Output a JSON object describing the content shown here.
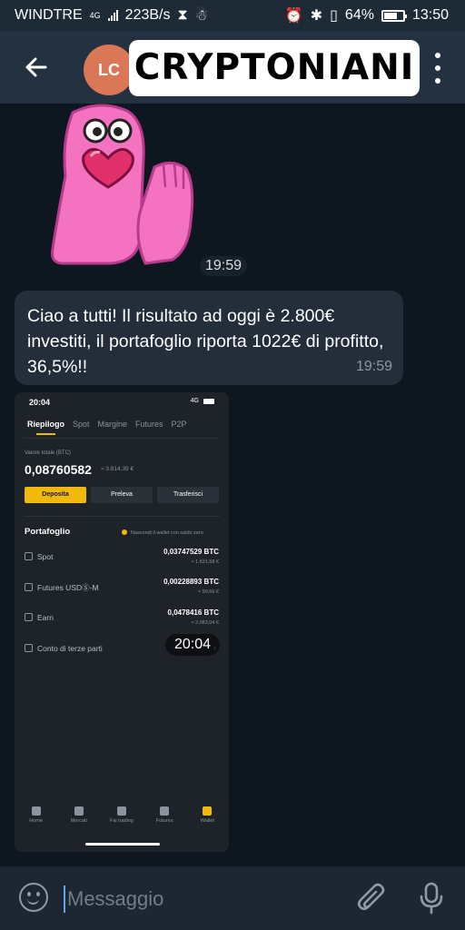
{
  "status_bar": {
    "carrier": "WINDTRE",
    "network": "4G",
    "speed": "223B/s",
    "battery": "64%",
    "time": "13:50"
  },
  "header": {
    "avatar_initials": "LC",
    "title": "CRYPTONIANI"
  },
  "messages": {
    "sticker_time": "19:59",
    "text": "Ciao a tutti! Il risultato ad oggi è 2.800€ investiti, il portafoglio riporta 1022€ di profitto, 36,5%!!",
    "text_time": "19:59",
    "image_time": "20:04"
  },
  "screenshot": {
    "status_time": "20:04",
    "status_network": "4G",
    "tabs": [
      "Riepilogo",
      "Spot",
      "Margine",
      "Futures",
      "P2P"
    ],
    "total_label": "Valore totale (BTC)",
    "total_value": "0,08760582",
    "total_fiat": "≈ 3.814,39 €",
    "buttons": [
      "Deposita",
      "Preleva",
      "Trasferisci"
    ],
    "portfolio_title": "Portafoglio",
    "hide_small": "Nascondi il wallet con saldo zero",
    "rows": [
      {
        "name": "Spot",
        "value": "0,03747529 BTC",
        "fiat": "≈ 1.631,68 €"
      },
      {
        "name": "Futures USDⓈ-M",
        "value": "0,00228893 BTC",
        "fiat": "≈ 99,66 €"
      },
      {
        "name": "Earn",
        "value": "0,0478416 BTC",
        "fiat": "≈ 2.083,04 €"
      }
    ],
    "third_party": "Conto di terze parti",
    "nav": [
      "Home",
      "Mercati",
      "Fai trading",
      "Futures",
      "Wallet"
    ]
  },
  "input": {
    "placeholder": "Messaggio"
  },
  "colors": {
    "chat_bg": "#0e1720",
    "header_bg": "#243140",
    "bubble_bg": "#232e3a",
    "avatar_bg": "#d97757",
    "accent": "#f0b90b"
  }
}
